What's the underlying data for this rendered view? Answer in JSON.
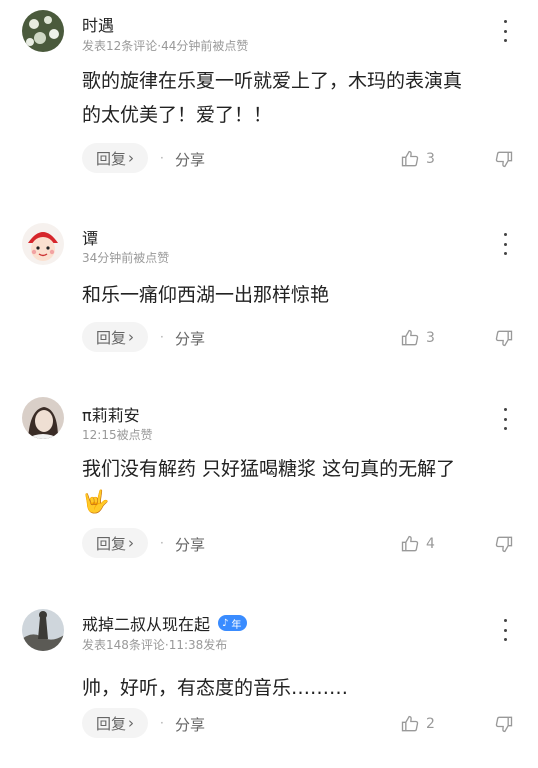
{
  "comments": [
    {
      "name": "时遇",
      "meta": "发表12条评论·44分钟前被点赞",
      "body_lines": [
        "歌的旋律在乐夏一听就爱上了，木玛的表演真",
        "的太优美了！爱了！！"
      ],
      "reply_label": "回复",
      "share_label": "分享",
      "likes": "3"
    },
    {
      "name": "谭",
      "meta": "34分钟前被点赞",
      "body_lines": [
        "和乐一痛仰西湖一出那样惊艳"
      ],
      "reply_label": "回复",
      "share_label": "分享",
      "likes": "3"
    },
    {
      "name": "π莉莉安",
      "meta": "12:15被点赞",
      "body_lines": [
        "我们没有解药 只好猛喝糖浆 这句真的无解了"
      ],
      "emoji": "🤟",
      "reply_label": "回复",
      "share_label": "分享",
      "likes": "4"
    },
    {
      "name": "戒掉二叔从现在起",
      "badge": "年",
      "meta": "发表148条评论·11:38发布",
      "body_lines": [
        "帅，好听，有态度的音乐………"
      ],
      "reply_label": "回复",
      "share_label": "分享",
      "likes": "2"
    }
  ],
  "icons": {
    "more": "more-vertical-icon",
    "like": "thumbs-up-icon",
    "dislike": "thumbs-down-icon",
    "chevron": "chevron-right-icon"
  }
}
